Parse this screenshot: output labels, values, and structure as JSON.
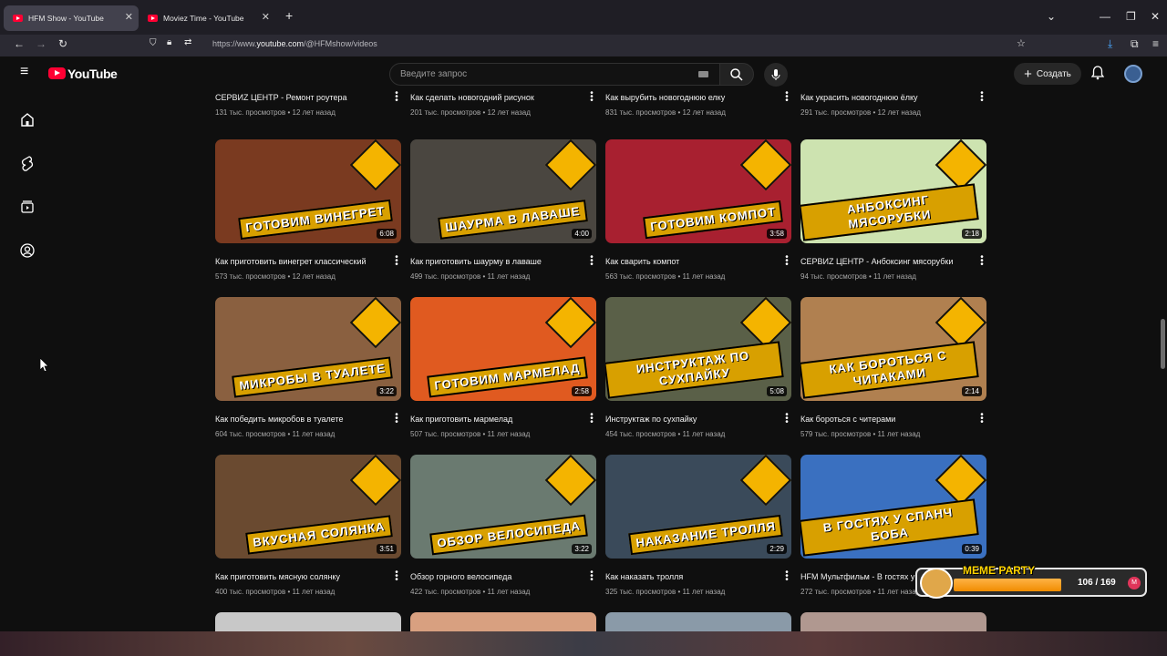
{
  "browser": {
    "tabs": [
      {
        "title": "HFM Show - YouTube",
        "active": true
      },
      {
        "title": "Moviez Time - YouTube",
        "active": false
      }
    ],
    "url_prefix": "https://www.",
    "url_host": "youtube.com",
    "url_path": "/@HFMshow/videos"
  },
  "youtube": {
    "logo": "YouTube",
    "search_placeholder": "Введите запрос",
    "create_label": "Создать"
  },
  "top_row": [
    {
      "title": "СЕРВИZ ЦЕНТР - Ремонт роутера",
      "meta": "131 тыс. просмотров • 12 лет назад"
    },
    {
      "title": "Как сделать новогодний рисунок",
      "meta": "201 тыс. просмотров • 12 лет назад"
    },
    {
      "title": "Как вырубить новогоднюю елку",
      "meta": "831 тыс. просмотров • 12 лет назад"
    },
    {
      "title": "Как украсить новогоднюю ёлку",
      "meta": "291 тыс. просмотров • 12 лет назад"
    }
  ],
  "videos": [
    {
      "title": "Как приготовить винегрет классический",
      "meta": "573 тыс. просмотров • 12 лет назад",
      "duration": "6:08",
      "caption": "ГОТОВИМ ВИНЕГРЕТ",
      "bg": "#7a3a20"
    },
    {
      "title": "Как приготовить шаурму в лаваше",
      "meta": "499 тыс. просмотров • 11 лет назад",
      "duration": "4:00",
      "caption": "ШАУРМА В ЛАВАШЕ",
      "bg": "#4a4640"
    },
    {
      "title": "Как сварить компот",
      "meta": "563 тыс. просмотров • 11 лет назад",
      "duration": "3:58",
      "caption": "ГОТОВИМ КОМПОТ",
      "bg": "#a82030"
    },
    {
      "title": "СЕРВИZ ЦЕНТР - Анбоксинг мясорубки",
      "meta": "94 тыс. просмотров • 11 лет назад",
      "duration": "2:18",
      "caption": "АНБОКСИНГ МЯСОРУБКИ",
      "bg": "#cde3b0"
    },
    {
      "title": "Как победить микробов в туалете",
      "meta": "604 тыс. просмотров • 11 лет назад",
      "duration": "3:22",
      "caption": "МИКРОБЫ В ТУАЛЕТЕ",
      "bg": "#8a6040"
    },
    {
      "title": "Как приготовить мармелад",
      "meta": "507 тыс. просмотров • 11 лет назад",
      "duration": "2:58",
      "caption": "ГОТОВИМ МАРМЕЛАД",
      "bg": "#e05a20"
    },
    {
      "title": "Инструктаж по сухпайку",
      "meta": "454 тыс. просмотров • 11 лет назад",
      "duration": "5:08",
      "caption": "ИНСТРУКТАЖ ПО СУХПАЙКУ",
      "bg": "#5a6048"
    },
    {
      "title": "Как бороться с читерами",
      "meta": "579 тыс. просмотров • 11 лет назад",
      "duration": "2:14",
      "caption": "КАК БОРОТЬСЯ С ЧИТАКАМИ",
      "bg": "#b08050"
    },
    {
      "title": "Как приготовить мясную солянку",
      "meta": "400 тыс. просмотров • 11 лет назад",
      "duration": "3:51",
      "caption": "ВКУСНАЯ СОЛЯНКА",
      "bg": "#6a4a30"
    },
    {
      "title": "Обзор горного велосипеда",
      "meta": "422 тыс. просмотров • 11 лет назад",
      "duration": "3:22",
      "caption": "ОБЗОР ВЕЛОСИПЕДА",
      "bg": "#6a7a70"
    },
    {
      "title": "Как наказать тролля",
      "meta": "325 тыс. просмотров • 11 лет назад",
      "duration": "2:29",
      "caption": "НАКАЗАНИЕ ТРОЛЛЯ",
      "bg": "#3a4a5a"
    },
    {
      "title": "HFM Мультфильм - В гостях у Спанч Боба",
      "meta": "272 тыс. просмотров • 11 лет назад",
      "duration": "0:39",
      "caption": "В ГОСТЯХ У СПАНЧ БОБА",
      "bg": "#3a70c0"
    }
  ],
  "overlay": {
    "label": "MEME PARTY",
    "count": "106 / 169",
    "coin": "M"
  }
}
